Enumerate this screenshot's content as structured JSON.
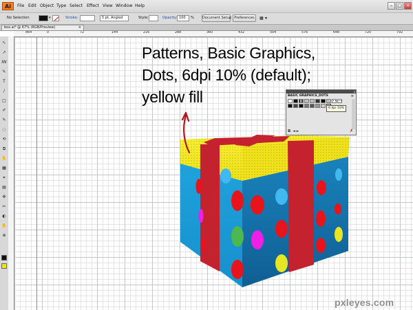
{
  "app": {
    "icon_label": "Ai"
  },
  "menubar": {
    "items": [
      "File",
      "Edit",
      "Object",
      "Type",
      "Select",
      "Effect",
      "View",
      "Window",
      "Help"
    ]
  },
  "window_controls": {
    "minimize": "–",
    "maximize": "□",
    "close": "×"
  },
  "controlbar": {
    "selection": "No Selection",
    "stroke_label": "Stroke:",
    "brush_value": "5 pt. Angled",
    "style_label": "Style:",
    "opacity_label": "Opacity:",
    "opacity_value": "100",
    "opacity_unit": "%",
    "document_setup": "Document Setup",
    "preferences": "Preferences"
  },
  "document": {
    "tab_title": "box.ai* @ 67% (RGB/Preview)",
    "tab_close": "×"
  },
  "ruler": {
    "labels": [
      "864",
      "0",
      "72",
      "144",
      "216",
      "288",
      "360",
      "432",
      "504",
      "576",
      "648",
      "720",
      "792"
    ]
  },
  "caption": {
    "lines": [
      "Patterns, Basic Graphics,",
      "Dots, 6dpi 10% (default);",
      "yellow fill"
    ]
  },
  "swatch_panel": {
    "title": "BASIC GRAPHICS_DOTS",
    "tooltip": "6 dpi 10%",
    "menu_icon": "≡",
    "close": "x",
    "bottom_icons": "◘.  ◄  ►",
    "delete_icon": "✗"
  },
  "toolbox": {
    "tools": [
      "↖",
      "↗",
      "ꟿ",
      "✎",
      "T",
      "/",
      "□",
      "✐",
      "✎",
      "◌",
      "⟲",
      "⧉",
      "✋",
      "▦",
      "⌗",
      "▤",
      "✜",
      "✂",
      "◐",
      "✋",
      "⊕"
    ]
  },
  "colors": {
    "box_front": "#1b9ad2",
    "box_side": "#1270a6",
    "lid_yellow": "#f6ef2a",
    "ribbon_red": "#c4222e",
    "dot_red": "#e8141c",
    "dot_green": "#4cb84e",
    "dot_magenta": "#ee1fe6",
    "dot_yellow": "#e8e624",
    "dot_light_blue": "#42b8f0",
    "annotation_arrow": "#b3141c"
  },
  "watermark": {
    "text": "pxleyes.com"
  }
}
